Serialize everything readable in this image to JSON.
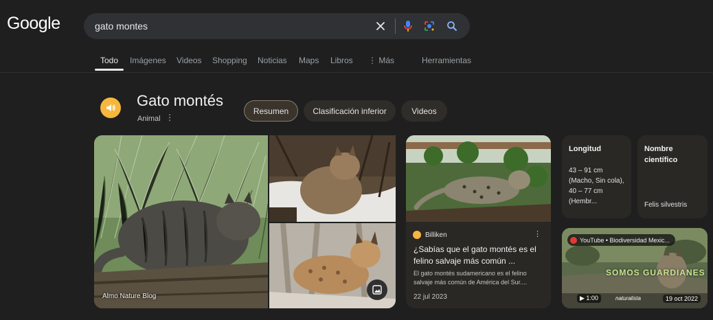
{
  "header": {
    "logo": "Google",
    "search_query": "gato montes"
  },
  "tabs": [
    {
      "label": "Todo",
      "active": true
    },
    {
      "label": "Imágenes"
    },
    {
      "label": "Videos"
    },
    {
      "label": "Shopping"
    },
    {
      "label": "Noticias"
    },
    {
      "label": "Maps"
    },
    {
      "label": "Libros"
    },
    {
      "label": "⋮ Más"
    },
    {
      "label": "Herramientas"
    }
  ],
  "entity": {
    "title": "Gato montés",
    "subtitle": "Animal",
    "menu_glyph": "⋮",
    "chips": [
      "Resumen",
      "Clasificación inferior",
      "Videos"
    ]
  },
  "images": {
    "main_credit": "Almo Nature Blog"
  },
  "article": {
    "source": "Billiken",
    "title": "¿Sabías que el gato montés es el felino salvaje más común ...",
    "snippet": "El gato montés sudamericano es el felino salvaje más común de América del Sur....",
    "date": "22 jul 2023"
  },
  "facts": [
    {
      "label": "Longitud",
      "value": "43 – 91 cm (Macho, Sin cola), 40 – 77 cm (Hembr..."
    },
    {
      "label": "Nombre científico",
      "value": "Felis silvestris"
    }
  ],
  "video": {
    "source": "YouTube • Biodiversidad Mexic...",
    "duration": "1:00",
    "date": "19 oct 2022",
    "brand": "naturalista",
    "overlay_title": "SOMOS GUARDIANES"
  },
  "colors": {
    "background": "#1f1f1f",
    "search_bg": "#303134",
    "card_bg": "#2a2824",
    "speaker_accent": "#f6b73c",
    "mic_blue": "#4285f4",
    "search_icon_blue": "#8ab4f8"
  }
}
